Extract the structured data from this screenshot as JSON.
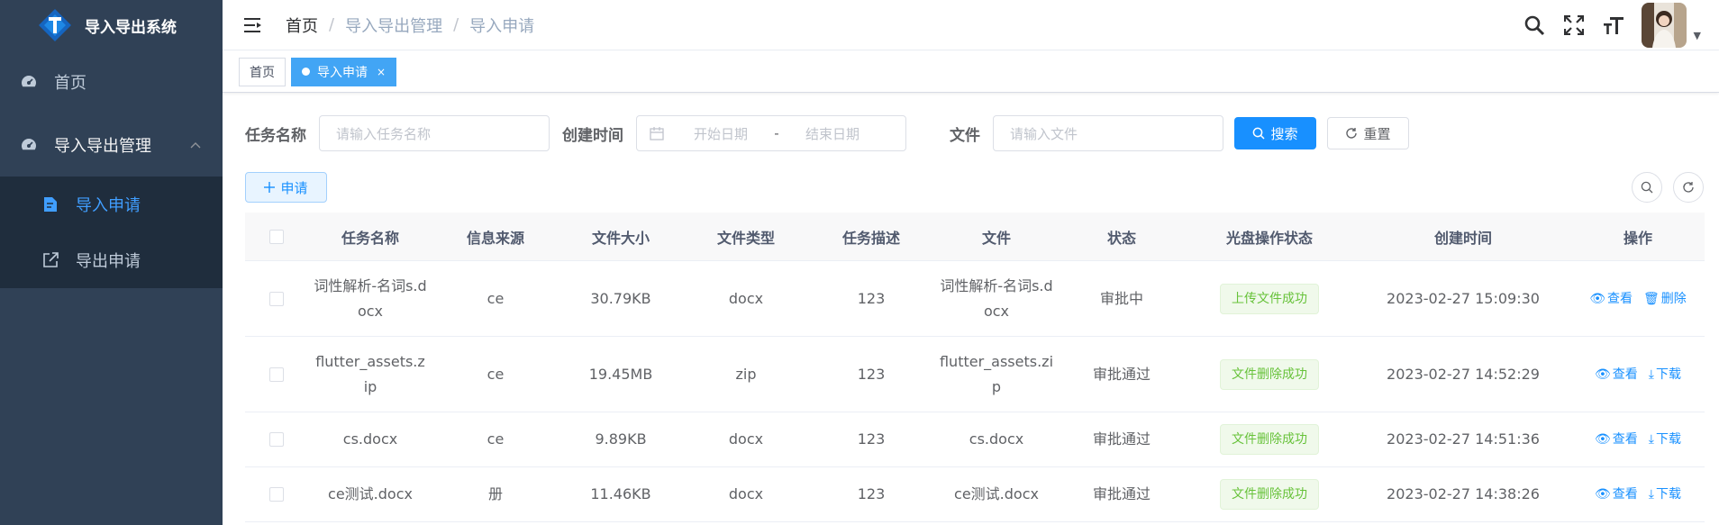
{
  "sidebar": {
    "title": "导入导出系统",
    "items": [
      {
        "label": "首页",
        "icon": "dashboard-icon"
      },
      {
        "label": "导入导出管理",
        "icon": "dashboard-icon",
        "expanded": true,
        "children": [
          {
            "label": "导入申请",
            "icon": "edit-doc-icon",
            "active": true
          },
          {
            "label": "导出申请",
            "icon": "external-link-icon"
          }
        ]
      }
    ]
  },
  "breadcrumb": [
    "首页",
    "导入导出管理",
    "导入申请"
  ],
  "breadcrumb_sep": "/",
  "tags": [
    {
      "label": "首页",
      "active": false
    },
    {
      "label": "导入申请",
      "active": true,
      "close": "×"
    }
  ],
  "search": {
    "task_label": "任务名称",
    "task_placeholder": "请输入任务名称",
    "time_label": "创建时间",
    "start_placeholder": "开始日期",
    "range_sep": "-",
    "end_placeholder": "结束日期",
    "file_label": "文件",
    "file_placeholder": "请输入文件",
    "search_btn": "搜索",
    "reset_btn": "重置"
  },
  "apply_btn": "申请",
  "table": {
    "headers": [
      "任务名称",
      "信息来源",
      "文件大小",
      "文件类型",
      "任务描述",
      "文件",
      "状态",
      "光盘操作状态",
      "创建时间",
      "操作"
    ],
    "rows": [
      {
        "name": "词性解析-名词s.docx",
        "source": "ce",
        "size": "30.79KB",
        "type": "docx",
        "desc": "123",
        "file": "词性解析-名词s.docx",
        "status": "审批中",
        "disc": "上传文件成功",
        "time": "2023-02-27 15:09:30",
        "op1": "查看",
        "op2": "删除",
        "op2_icon": "trash-icon"
      },
      {
        "name": "flutter_assets.zip",
        "source": "ce",
        "size": "19.45MB",
        "type": "zip",
        "desc": "123",
        "file": "flutter_assets.zip",
        "status": "审批通过",
        "disc": "文件删除成功",
        "time": "2023-02-27 14:52:29",
        "op1": "查看",
        "op2": "下载",
        "op2_icon": "download-icon"
      },
      {
        "name": "cs.docx",
        "source": "ce",
        "size": "9.89KB",
        "type": "docx",
        "desc": "123",
        "file": "cs.docx",
        "status": "审批通过",
        "disc": "文件删除成功",
        "time": "2023-02-27 14:51:36",
        "op1": "查看",
        "op2": "下载",
        "op2_icon": "download-icon"
      },
      {
        "name": "ce测试.docx",
        "source": "册",
        "size": "11.46KB",
        "type": "docx",
        "desc": "123",
        "file": "ce测试.docx",
        "status": "审批通过",
        "disc": "文件删除成功",
        "time": "2023-02-27 14:38:26",
        "op1": "查看",
        "op2": "下载",
        "op2_icon": "download-icon"
      }
    ]
  },
  "colors": {
    "sidebar_bg": "#304156",
    "submenu_bg": "#1f2d3d",
    "primary": "#1890ff",
    "tag_active": "#42a5f5",
    "success": "#67c23a"
  }
}
